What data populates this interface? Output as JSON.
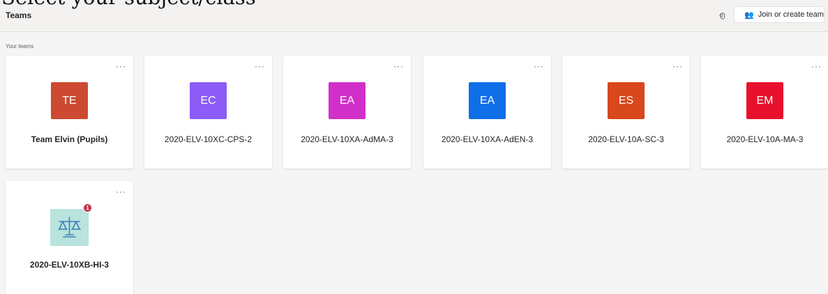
{
  "overlay_caption": "Select your subject/class",
  "header": {
    "title": "Teams",
    "settings_icon": "gear-icon",
    "join_button_label": "Join or create team",
    "join_icon": "people-add-icon"
  },
  "section": {
    "label": "Your teams"
  },
  "teams": [
    {
      "initials": "TE",
      "name": "Team Elvin (Pupils)",
      "color": "#cc4a31",
      "bold": true
    },
    {
      "initials": "EC",
      "name": "2020-ELV-10XC-CPS-2",
      "color": "#8b5cf6"
    },
    {
      "initials": "EA",
      "name": "2020-ELV-10XA-AdMA-3",
      "color": "#d12fc9"
    },
    {
      "initials": "EA",
      "name": "2020-ELV-10XA-AdEN-3",
      "color": "#0f6ee8"
    },
    {
      "initials": "ES",
      "name": "2020-ELV-10A-SC-3",
      "color": "#d9471c"
    },
    {
      "initials": "EM",
      "name": "2020-ELV-10A-MA-3",
      "color": "#e8112d"
    },
    {
      "initials": "",
      "name": "2020-ELV-10XB-HI-3",
      "color": "#b9e3dd",
      "bold": true,
      "badge": "1",
      "icon": "scales-icon"
    }
  ],
  "more_label": "···"
}
